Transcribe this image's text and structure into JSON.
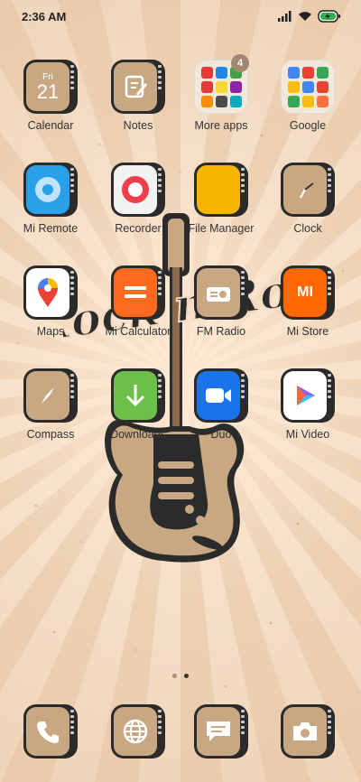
{
  "status": {
    "time": "2:36 AM",
    "battery_icon": "battery-charging-icon",
    "signal_icon": "signal-icon",
    "wifi_icon": "wifi-icon"
  },
  "colors": {
    "tan": "#c8a882",
    "dark": "#2b2b2b",
    "background": "#f3d9bf"
  },
  "wallpaper": {
    "text": "Rock n Roll"
  },
  "apps": [
    {
      "label": "Calendar",
      "day": "Fri",
      "date": "21"
    },
    {
      "label": "Notes"
    },
    {
      "label": "More apps",
      "badge": "4"
    },
    {
      "label": "Google"
    },
    {
      "label": "Mi Remote"
    },
    {
      "label": "Recorder"
    },
    {
      "label": "File Manager"
    },
    {
      "label": "Clock"
    },
    {
      "label": "Maps"
    },
    {
      "label": "Mi Calculator"
    },
    {
      "label": "FM Radio"
    },
    {
      "label": "Mi Store",
      "glyph": "MI"
    },
    {
      "label": "Compass"
    },
    {
      "label": "Downloads"
    },
    {
      "label": "Duo"
    },
    {
      "label": "Mi Video"
    }
  ],
  "dock": [
    {
      "name": "phone-icon"
    },
    {
      "name": "browser-icon"
    },
    {
      "name": "messages-icon"
    },
    {
      "name": "camera-icon"
    }
  ],
  "page_indicator": {
    "pages": 2,
    "current": 2
  }
}
